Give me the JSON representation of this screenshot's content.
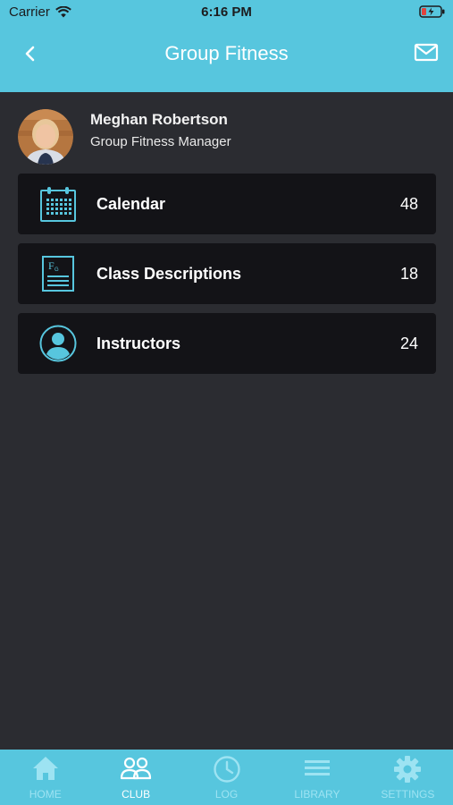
{
  "status": {
    "carrier": "Carrier",
    "time": "6:16 PM"
  },
  "header": {
    "title": "Group Fitness",
    "back_icon": "chevron-left-icon",
    "mail_icon": "mail-icon"
  },
  "profile": {
    "name": "Meghan Robertson",
    "role": "Group Fitness Manager"
  },
  "menu": [
    {
      "label": "Calendar",
      "count": "48",
      "icon": "calendar-icon"
    },
    {
      "label": "Class Descriptions",
      "count": "18",
      "icon": "document-icon"
    },
    {
      "label": "Instructors",
      "count": "24",
      "icon": "person-icon"
    }
  ],
  "tabs": [
    {
      "label": "HOME",
      "icon": "home-icon",
      "active": false
    },
    {
      "label": "CLUB",
      "icon": "group-icon",
      "active": true
    },
    {
      "label": "LOG",
      "icon": "clock-icon",
      "active": false
    },
    {
      "label": "LIBRARY",
      "icon": "menu-icon",
      "active": false
    },
    {
      "label": "SETTINGS",
      "icon": "gear-icon",
      "active": false
    }
  ],
  "colors": {
    "accent": "#57c6de",
    "background": "#2b2c31",
    "card": "#131317"
  }
}
